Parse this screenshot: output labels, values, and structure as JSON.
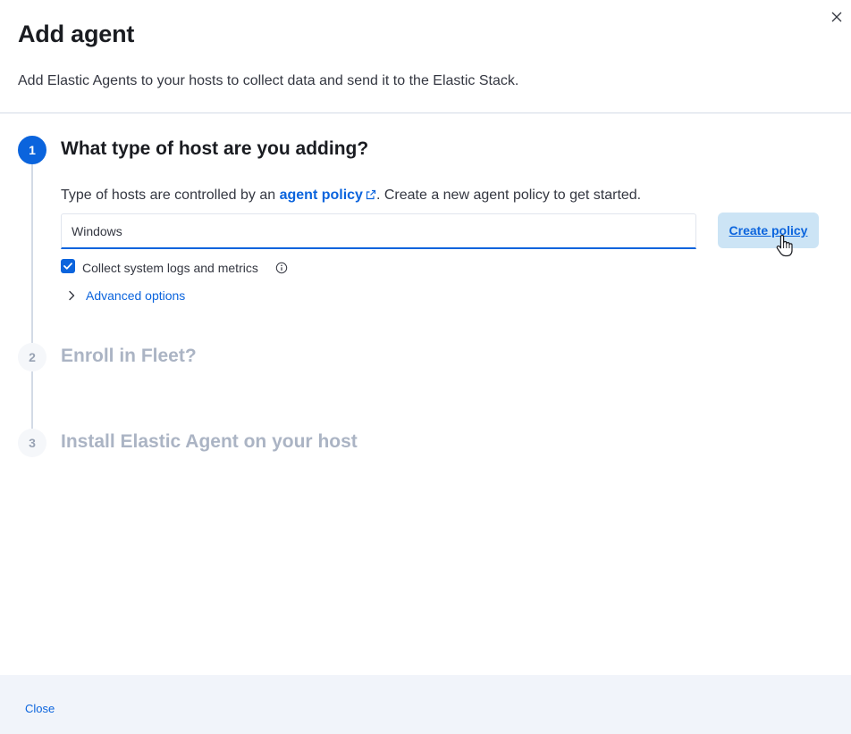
{
  "flyout": {
    "title": "Add agent",
    "subtitle": "Add Elastic Agents to your hosts to collect data and send it to the Elastic Stack.",
    "close_icon": "close-icon"
  },
  "steps": [
    {
      "number": "1",
      "title": "What type of host are you adding?",
      "state": "active",
      "description_prefix": "Type of hosts are controlled by an ",
      "description_link": "agent policy",
      "description_suffix": ". Create a new agent policy to get started.",
      "policy_name_value": "Windows",
      "create_button_label": "Create policy",
      "checkbox_label": "Collect system logs and metrics",
      "checkbox_checked": true,
      "advanced_options_label": "Advanced options"
    },
    {
      "number": "2",
      "title": "Enroll in Fleet?",
      "state": "inactive"
    },
    {
      "number": "3",
      "title": "Install Elastic Agent on your host",
      "state": "inactive"
    }
  ],
  "footer": {
    "close_label": "Close"
  },
  "colors": {
    "primary": "#0b64dd",
    "button_bg": "#cce4f5",
    "footer_bg": "#f1f4fa",
    "inactive_text": "#abb4c4"
  }
}
